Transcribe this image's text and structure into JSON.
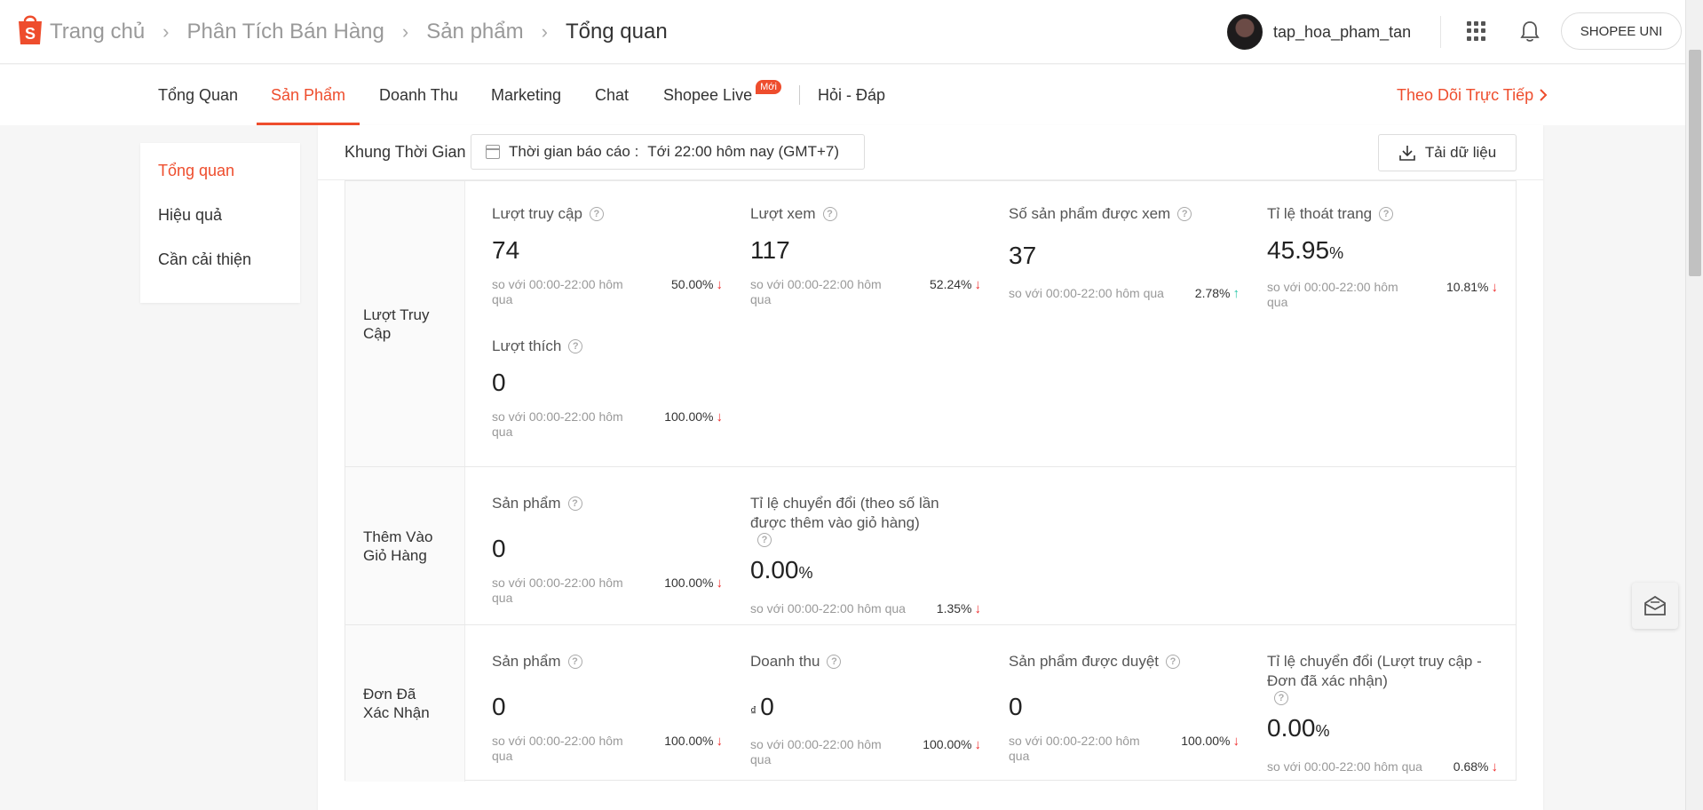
{
  "header": {
    "breadcrumbs": [
      "Trang chủ",
      "Phân Tích Bán Hàng",
      "Sản phẩm",
      "Tổng quan"
    ],
    "username": "tap_hoa_pham_tan",
    "uni_button": "SHOPEE UNI"
  },
  "tabs": {
    "items": [
      "Tổng Quan",
      "Sản Phẩm",
      "Doanh Thu",
      "Marketing",
      "Chat",
      "Shopee Live",
      "Hỏi - Đáp"
    ],
    "new_badge": "Mới",
    "active": "Sản Phẩm",
    "live_link": "Theo Dõi Trực Tiếp"
  },
  "sidebar": {
    "items": [
      "Tổng quan",
      "Hiệu quả",
      "Cần cải thiện"
    ]
  },
  "filter": {
    "label": "Khung Thời Gian",
    "date_prefix": "Thời gian báo cáo :",
    "date_value": "Tới 22:00 hôm nay (GMT+7)",
    "download": "Tải dữ liệu"
  },
  "sections": [
    {
      "label": "Lượt Truy Cập",
      "metrics": [
        {
          "title": "Lượt truy cập",
          "value": "74",
          "compare": "so với 00:00-22:00 hôm qua",
          "change": "50.00%",
          "dir": "down"
        },
        {
          "title": "Lượt xem",
          "value": "117",
          "compare": "so với 00:00-22:00 hôm qua",
          "change": "52.24%",
          "dir": "down"
        },
        {
          "title": "Số sản phẩm được xem",
          "value": "37",
          "compare": "so với 00:00-22:00 hôm qua",
          "change": "2.78%",
          "dir": "up"
        },
        {
          "title": "Tỉ lệ thoát trang",
          "value": "45.95",
          "unit": "%",
          "compare": "so với 00:00-22:00 hôm qua",
          "change": "10.81%",
          "dir": "down"
        },
        {
          "title": "Lượt thích",
          "value": "0",
          "compare": "so với 00:00-22:00 hôm qua",
          "change": "100.00%",
          "dir": "down"
        }
      ]
    },
    {
      "label": "Thêm Vào Giỏ Hàng",
      "metrics": [
        {
          "title": "Sản phẩm",
          "value": "0",
          "compare": "so với 00:00-22:00 hôm qua",
          "change": "100.00%",
          "dir": "down"
        },
        {
          "title": "Tỉ lệ chuyển đổi (theo số lần được thêm vào giỏ hàng)",
          "value": "0.00",
          "unit": "%",
          "compare": "so với 00:00-22:00 hôm qua",
          "change": "1.35%",
          "dir": "down"
        }
      ]
    },
    {
      "label": "Đơn Đã Xác Nhận",
      "metrics": [
        {
          "title": "Sản phẩm",
          "value": "0",
          "compare": "so với 00:00-22:00 hôm qua",
          "change": "100.00%",
          "dir": "down"
        },
        {
          "title": "Doanh thu",
          "currency": "₫",
          "value": "0",
          "compare": "so với 00:00-22:00 hôm qua",
          "change": "100.00%",
          "dir": "down"
        },
        {
          "title": "Sản phẩm được duyệt",
          "value": "0",
          "compare": "so với 00:00-22:00 hôm qua",
          "change": "100.00%",
          "dir": "down"
        },
        {
          "title": "Tỉ lệ chuyển đổi (Lượt truy cập - Đơn đã xác nhận)",
          "value": "0.00",
          "unit": "%",
          "compare": "so với 00:00-22:00 hôm qua",
          "change": "0.68%",
          "dir": "down"
        }
      ]
    }
  ],
  "colors": {
    "accent": "#ee4d2d",
    "down": "#ee2c2c",
    "up": "#26c6a6"
  },
  "icons": [
    "shopee-logo-icon",
    "apps-grid-icon",
    "bell-icon",
    "chevron-right-icon",
    "calendar-icon",
    "download-icon",
    "help-circle-icon",
    "arrow-down-icon",
    "arrow-up-icon",
    "mail-icon"
  ]
}
